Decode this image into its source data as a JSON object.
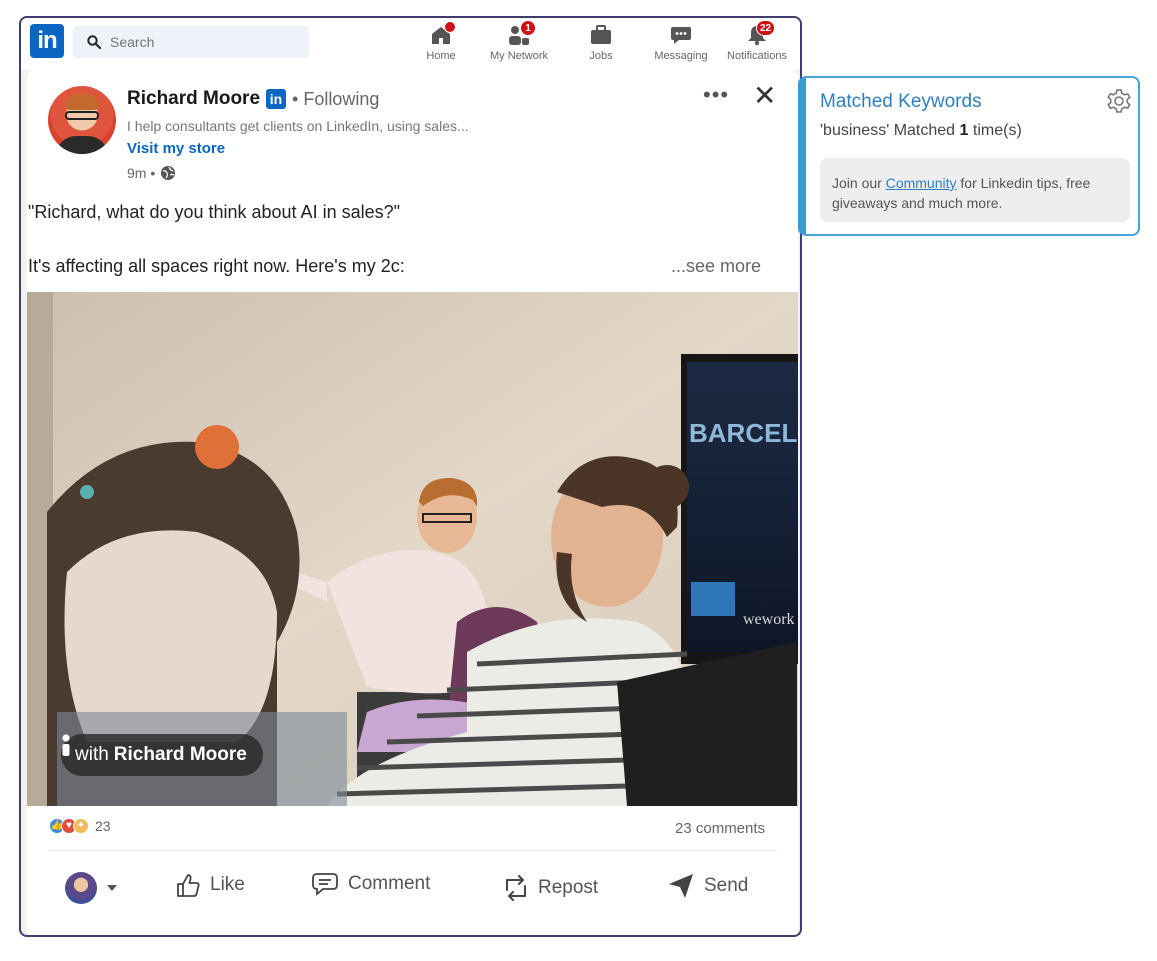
{
  "topnav": {
    "logo_text": "in",
    "search": {
      "placeholder": "Search",
      "value": ""
    },
    "items": [
      {
        "label": "Home",
        "icon": "home-icon",
        "badge": "dot"
      },
      {
        "label": "My Network",
        "icon": "network-icon",
        "badge": "1"
      },
      {
        "label": "Jobs",
        "icon": "briefcase-icon",
        "badge": ""
      },
      {
        "label": "Messaging",
        "icon": "message-icon",
        "badge": ""
      },
      {
        "label": "Notifications",
        "icon": "bell-icon",
        "badge": "22"
      }
    ]
  },
  "post": {
    "author": {
      "name": "Richard Moore",
      "premium_badge": "in",
      "relation": "• Following",
      "headline": "I help consultants get clients on LinkedIn, using sales...",
      "link": "Visit my store",
      "time": "9m •"
    },
    "text_line1": "\"Richard, what do you think about AI in sales?\"",
    "text_line2": "It's affecting all spaces right now. Here's my 2c:",
    "see_more": "...see more",
    "image": {
      "tag_prefix": "with",
      "tag_name": "Richard Moore",
      "screen_text_1": "BARCELONA",
      "screen_text_2": "wework"
    },
    "reaction_count": "23",
    "comments_count": "23 comments",
    "actions": {
      "like": "Like",
      "comment": "Comment",
      "repost": "Repost",
      "send": "Send"
    }
  },
  "side_panel": {
    "title": "Matched Keywords",
    "match_keyword": "'business' Matched",
    "match_count": "1",
    "match_suffix": "time(s)",
    "join_prefix": "Join our",
    "join_link": "Community",
    "join_suffix": "for Linkedin tips, free giveaways and much more."
  },
  "colors": {
    "linkedin_blue": "#0a66c2",
    "notification_red": "#cc1016",
    "frame_border": "#3f3d6e",
    "panel_accent": "#3a9ad9"
  }
}
